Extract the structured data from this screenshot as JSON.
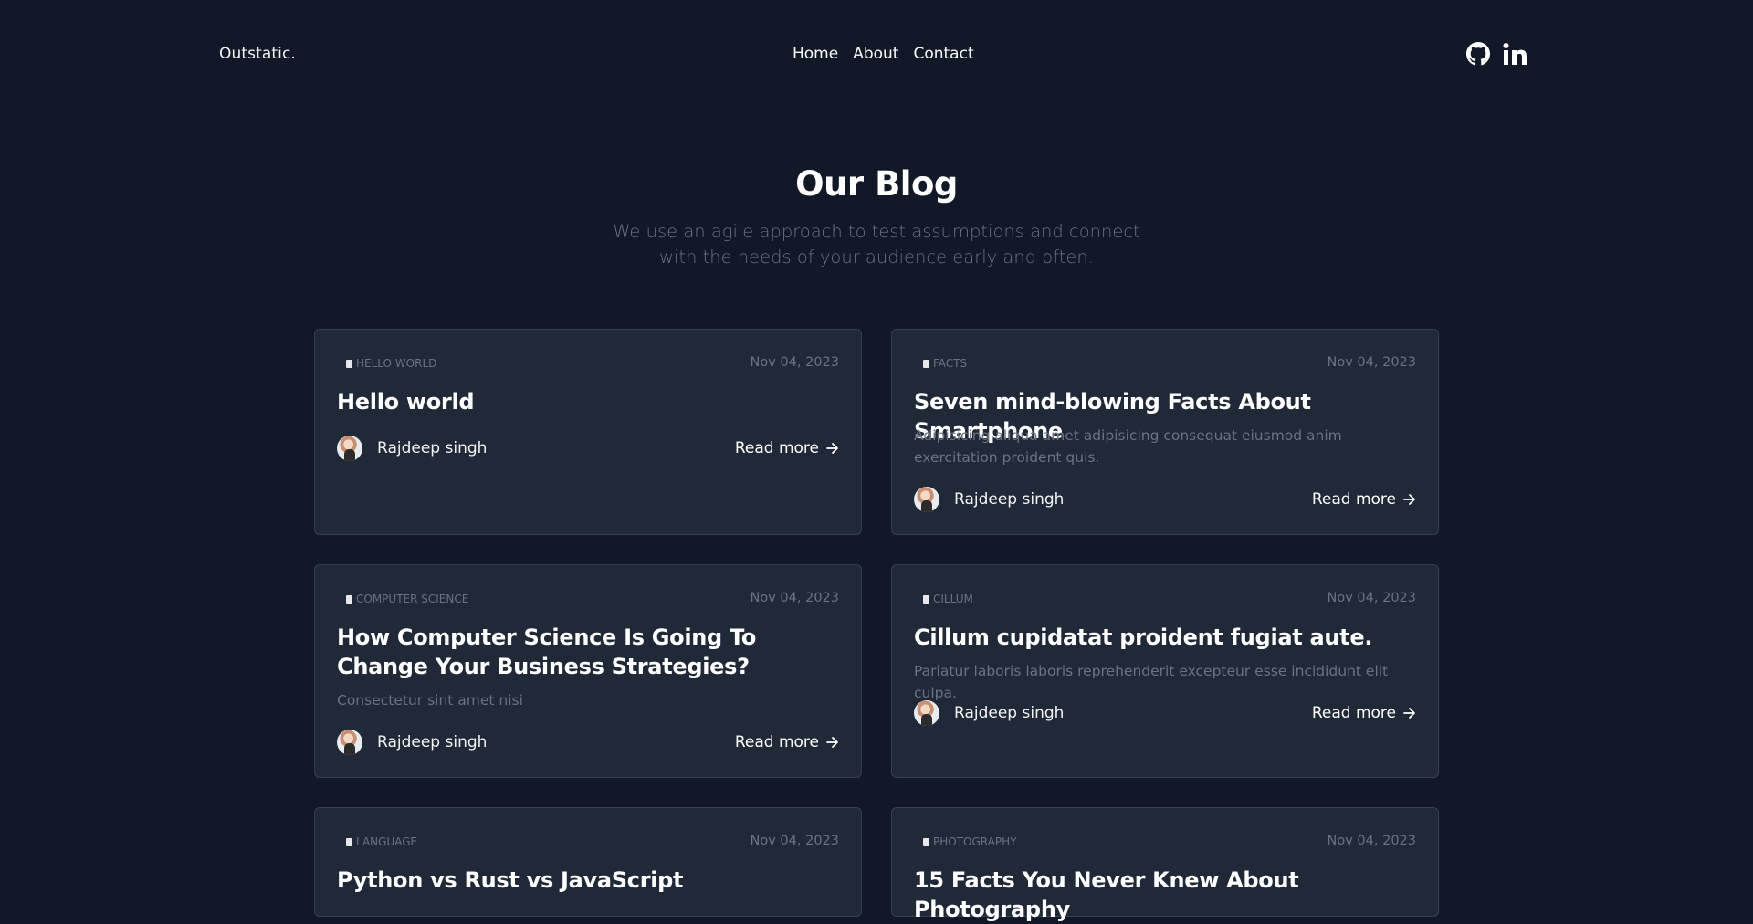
{
  "nav": {
    "brand": "Outstatic.",
    "links": [
      "Home",
      "About",
      "Contact"
    ],
    "social_icons": [
      "github-icon",
      "linkedin-icon"
    ]
  },
  "hero": {
    "title": "Our Blog",
    "subtitle": "We use an agile approach to test assumptions and connect with the needs of your audience early and often."
  },
  "posts": [
    {
      "category": "HELLO WORLD",
      "date": "Nov 04, 2023",
      "title": "Hello world",
      "excerpt": "",
      "author": "Rajdeep singh",
      "cta": "Read more"
    },
    {
      "category": "FACTS",
      "date": "Nov 04, 2023",
      "title": "Seven mind-blowing Facts About Smartphone",
      "excerpt": "Adipisicing aliqua amet adipisicing consequat eiusmod anim exercitation proident quis.",
      "author": "Rajdeep singh",
      "cta": "Read more"
    },
    {
      "category": "COMPUTER SCIENCE",
      "date": "Nov 04, 2023",
      "title": "How Computer Science Is Going To Change Your Business Strategies?",
      "excerpt": "Consectetur sint amet nisi",
      "author": "Rajdeep singh",
      "cta": "Read more"
    },
    {
      "category": "CILLUM",
      "date": "Nov 04, 2023",
      "title": "Cillum cupidatat proident fugiat aute.",
      "excerpt": "Pariatur laboris laboris reprehenderit excepteur esse incididunt elit culpa.",
      "author": "Rajdeep singh",
      "cta": "Read more"
    },
    {
      "category": "LANGUAGE",
      "date": "Nov 04, 2023",
      "title": "Python vs Rust vs JavaScript",
      "excerpt": "",
      "author": "",
      "cta": ""
    },
    {
      "category": "PHOTOGRAPHY",
      "date": "Nov 04, 2023",
      "title": "15 Facts You Never Knew About Photography",
      "excerpt": "",
      "author": "",
      "cta": ""
    }
  ]
}
